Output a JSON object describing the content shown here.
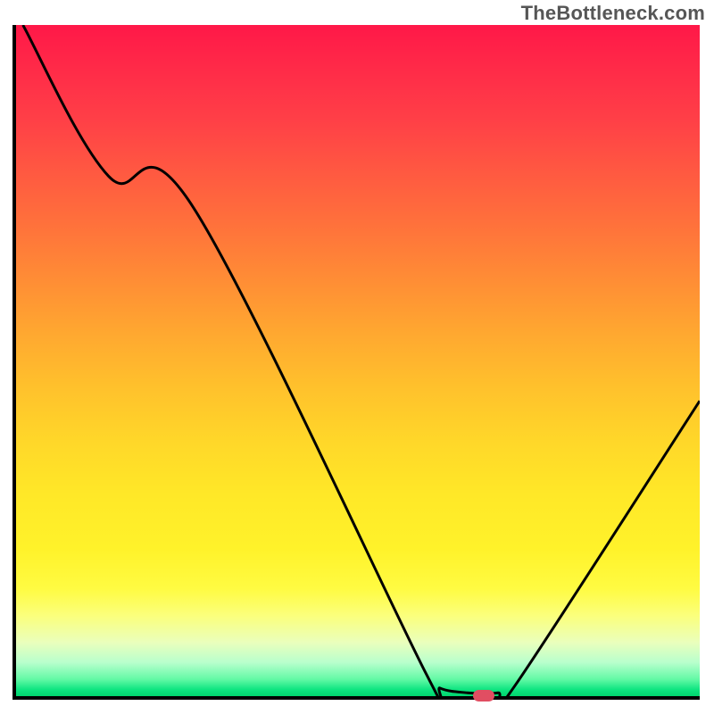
{
  "watermark": "TheBottleneck.com",
  "chart_data": {
    "type": "line",
    "title": "",
    "xlabel": "",
    "ylabel": "",
    "xlim": [
      0,
      100
    ],
    "ylim": [
      0,
      100
    ],
    "series": [
      {
        "name": "curve",
        "points": [
          {
            "x": 1.0,
            "y": 100.0
          },
          {
            "x": 13.5,
            "y": 77.5
          },
          {
            "x": 26.0,
            "y": 72.7
          },
          {
            "x": 60.0,
            "y": 3.3
          },
          {
            "x": 62.0,
            "y": 1.2
          },
          {
            "x": 66.0,
            "y": 0.5
          },
          {
            "x": 70.5,
            "y": 0.5
          },
          {
            "x": 73.0,
            "y": 1.6
          },
          {
            "x": 100.0,
            "y": 44.0
          }
        ]
      }
    ],
    "marker": {
      "x": 68.0,
      "y": 0.7
    }
  },
  "colors": {
    "gradient_top": "#ff1848",
    "gradient_mid": "#ffd729",
    "gradient_bottom": "#00d56e",
    "curve": "#000000",
    "marker": "#e14e62",
    "axes": "#000000"
  }
}
